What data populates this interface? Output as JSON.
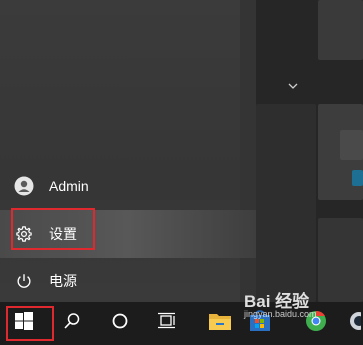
{
  "start_menu": {
    "items": [
      {
        "label": "Admin",
        "icon": "user-icon"
      },
      {
        "label": "设置",
        "icon": "gear-icon"
      },
      {
        "label": "电源",
        "icon": "power-icon"
      }
    ],
    "expand_icon": "chevron-down-icon"
  },
  "taskbar": {
    "buttons": [
      {
        "icon": "windows-logo-icon"
      },
      {
        "icon": "search-icon"
      },
      {
        "icon": "cortana-icon"
      },
      {
        "icon": "task-view-icon"
      },
      {
        "icon": "file-explorer-icon"
      },
      {
        "icon": "store-icon"
      },
      {
        "icon": "chrome-icon"
      },
      {
        "icon": "app-icon"
      }
    ]
  },
  "watermark": {
    "brand": "Bai 经验",
    "url": "jingyan.baidu.com"
  },
  "colors": {
    "highlight": "#e0282f",
    "taskbar": "#1c1c1c",
    "panel": "#343434"
  }
}
